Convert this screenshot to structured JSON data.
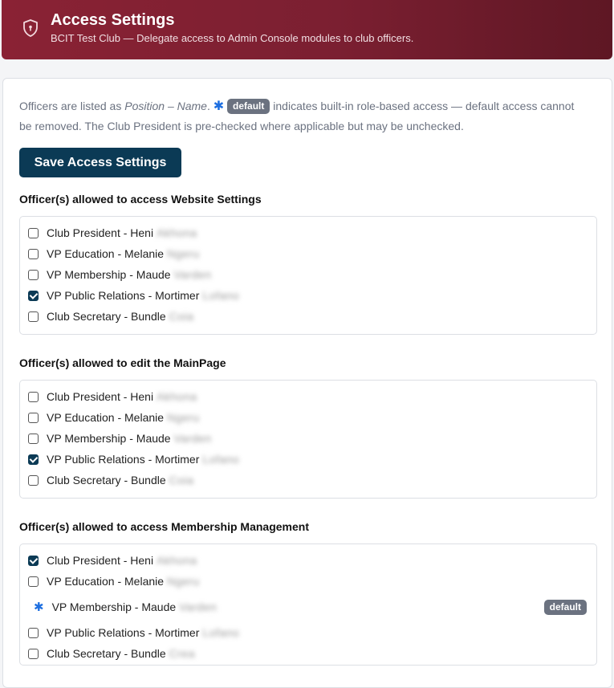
{
  "header": {
    "title": "Access Settings",
    "subtitle": "BCIT Test Club — Delegate access to Admin Console modules to club officers."
  },
  "intro": {
    "part1": "Officers are listed as ",
    "position_name": "Position – Name",
    "part2": ". ",
    "asterisk": "✱",
    "badge": "default",
    "part3": " indicates built-in role-based access — default access cannot be removed. The Club President is pre-checked where applicable but may be unchecked."
  },
  "save_button": {
    "label": "Save Access Settings"
  },
  "colors": {
    "header": "#7b1f31",
    "button": "#0b3a55",
    "asterisk": "#1e6fe0",
    "badge": "#6b7280"
  },
  "sections": [
    {
      "title": "Officer(s) allowed to access Website Settings",
      "officers": [
        {
          "label": "Club President - Heni",
          "surname": "Akhona",
          "checked": false
        },
        {
          "label": "VP Education - Melanie",
          "surname": "Ngeru",
          "checked": false
        },
        {
          "label": "VP Membership - Maude",
          "surname": "Varden",
          "checked": false
        },
        {
          "label": "VP Public Relations - Mortimer",
          "surname": "Lofano",
          "checked": true
        },
        {
          "label": "Club Secretary - Bundle",
          "surname": "Coia",
          "checked": false
        }
      ]
    },
    {
      "title": "Officer(s) allowed to edit the MainPage",
      "officers": [
        {
          "label": "Club President - Heni",
          "surname": "Akhona",
          "checked": false
        },
        {
          "label": "VP Education - Melanie",
          "surname": "Ngeru",
          "checked": false
        },
        {
          "label": "VP Membership - Maude",
          "surname": "Varden",
          "checked": false
        },
        {
          "label": "VP Public Relations - Mortimer",
          "surname": "Lofano",
          "checked": true
        },
        {
          "label": "Club Secretary - Bundle",
          "surname": "Coia",
          "checked": false
        }
      ]
    },
    {
      "title": "Officer(s) allowed to access Membership Management",
      "officers": [
        {
          "label": "Club President - Heni",
          "surname": "Akhona",
          "checked": true
        },
        {
          "label": "VP Education - Melanie",
          "surname": "Ngeru",
          "checked": false
        },
        {
          "label": "VP Membership - Maude",
          "surname": "Varden",
          "default": true,
          "badge": "default"
        },
        {
          "label": "VP Public Relations - Mortimer",
          "surname": "Lofano",
          "checked": false
        },
        {
          "label": "Club Secretary - Bundle",
          "surname": "Crea",
          "checked": false
        }
      ]
    }
  ]
}
